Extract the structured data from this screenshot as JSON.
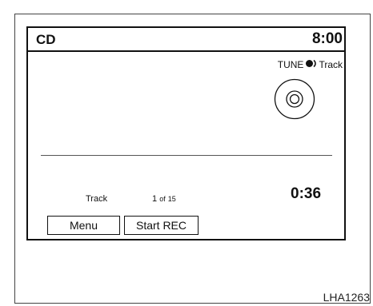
{
  "header": {
    "source": "CD",
    "clock": "8:00"
  },
  "tune_hint": {
    "prefix": "TUNE",
    "icon": "tune-knob-icon",
    "suffix": "Track"
  },
  "media": {
    "icon": "cd-disc-icon",
    "track_label": "Track",
    "track_current": "1",
    "track_of": "of",
    "track_total": "15",
    "elapsed": "0:36"
  },
  "buttons": {
    "menu": "Menu",
    "start_rec": "Start REC"
  },
  "caption": "LHA1263"
}
